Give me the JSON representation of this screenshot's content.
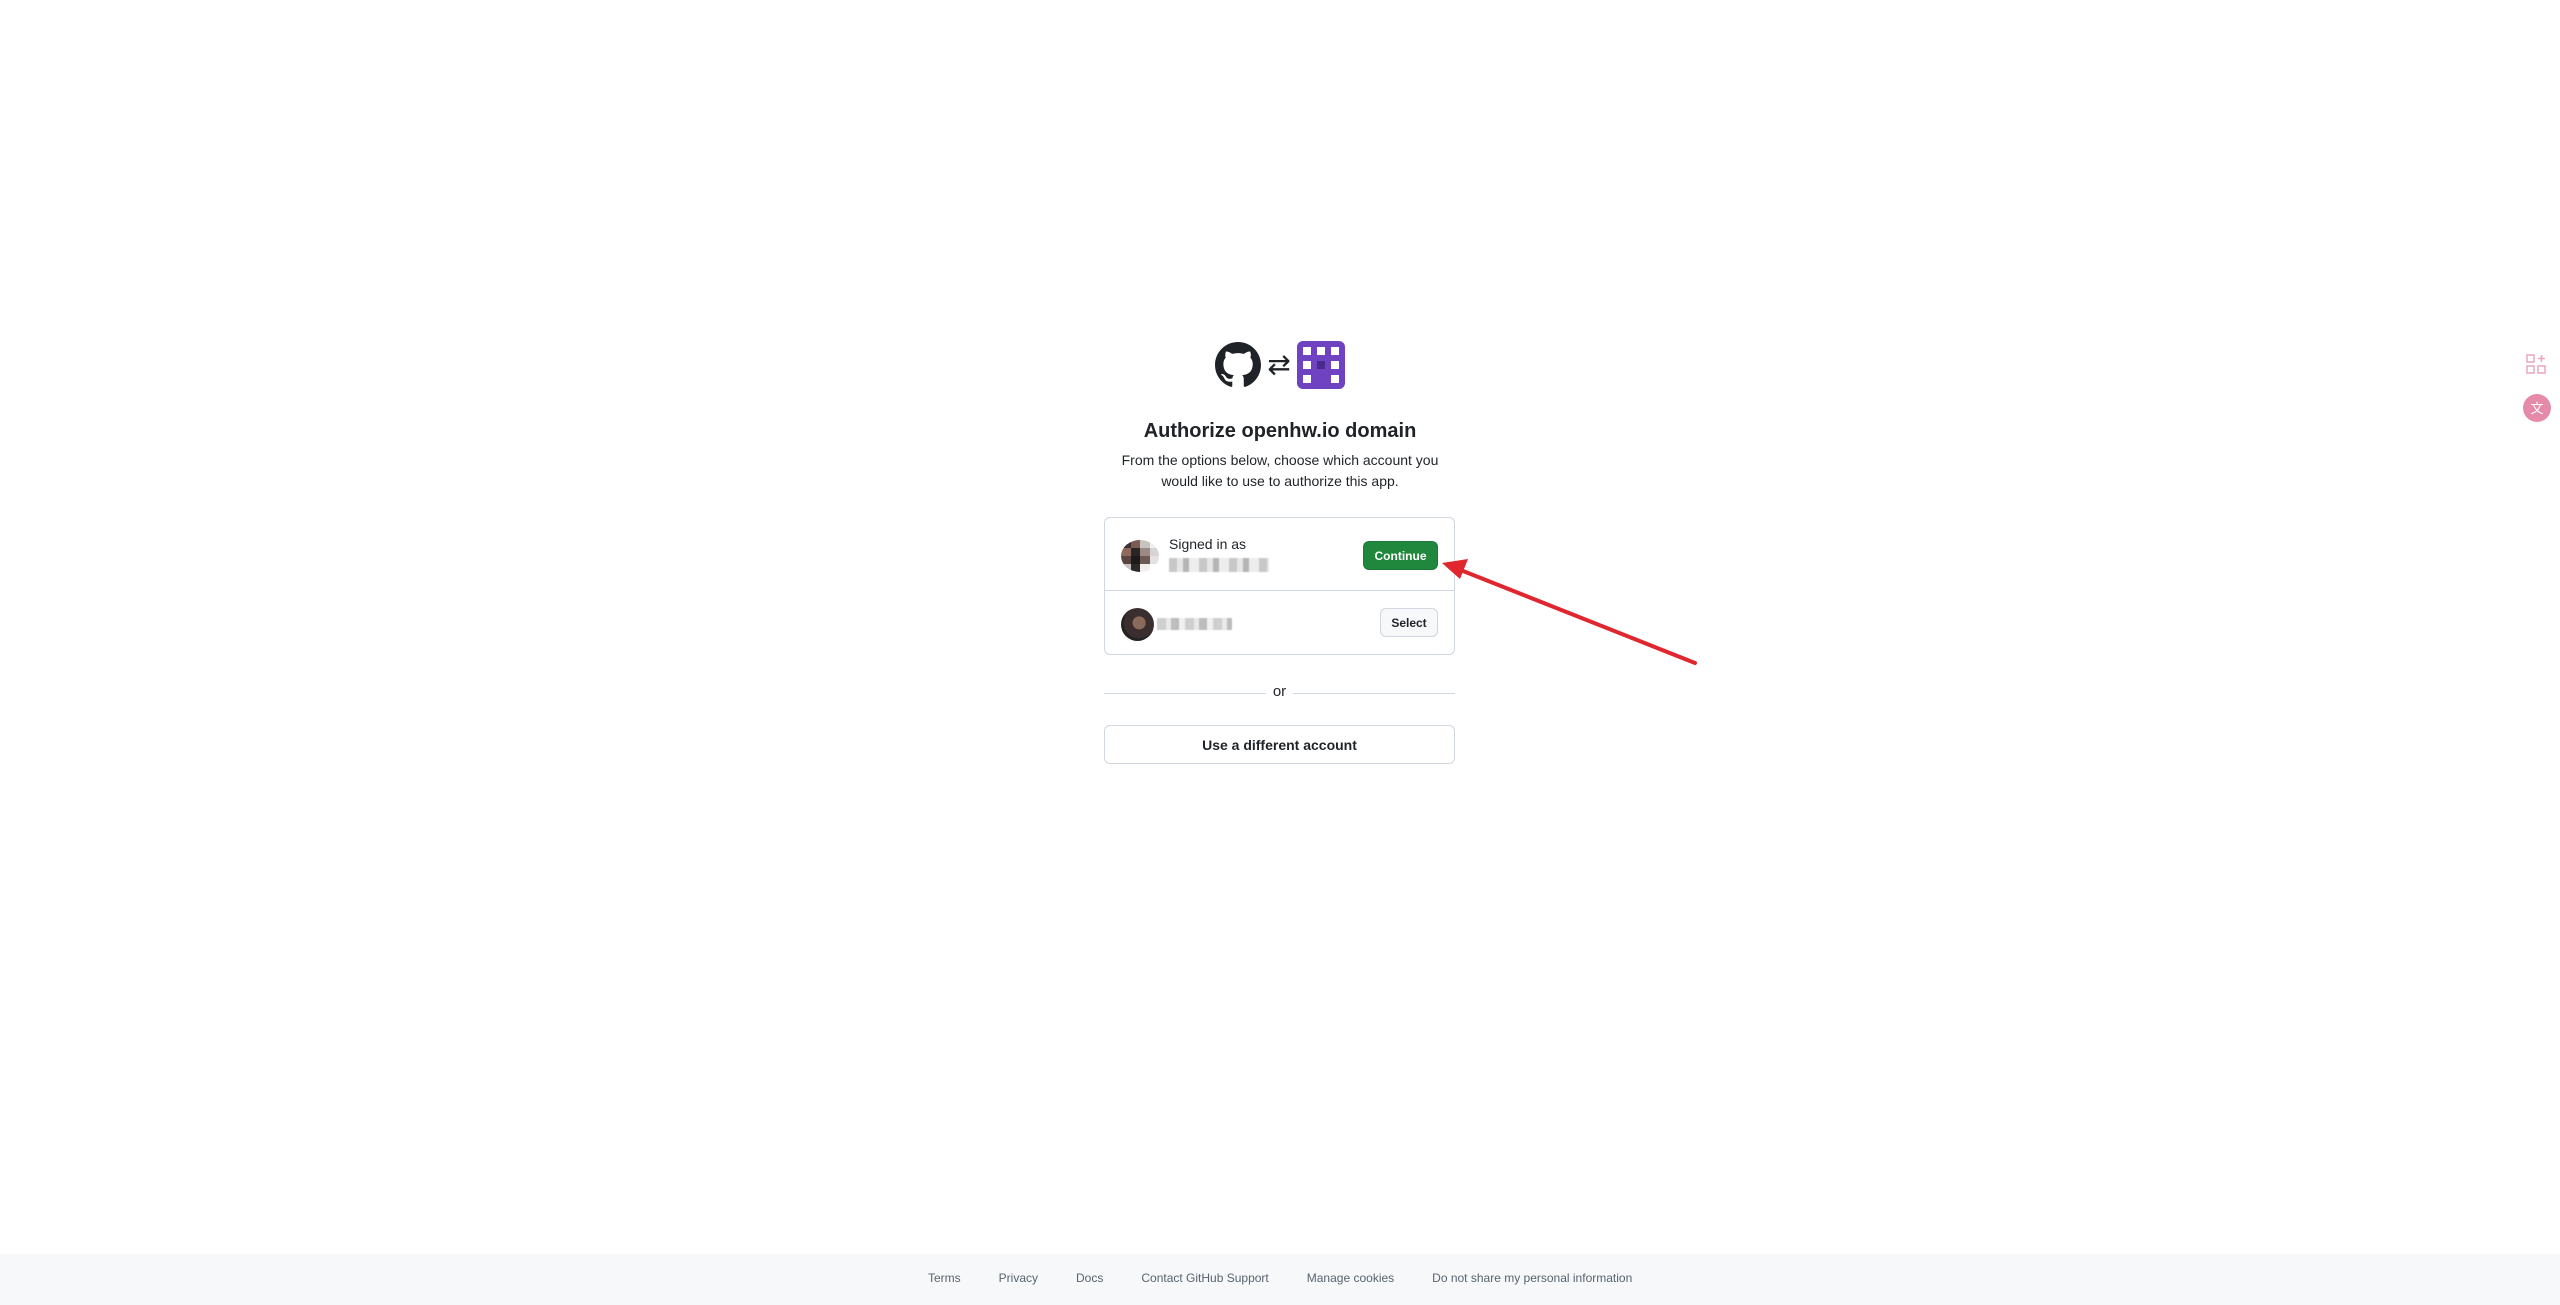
{
  "header": {
    "title": "Authorize openhw.io domain",
    "subtitle": "From the options below, choose which account you would like to use to authorize this app.",
    "swap_symbol": "⇄",
    "left_logo": "github-icon",
    "right_logo": "app-logo-icon"
  },
  "accounts": [
    {
      "status_label": "Signed in as",
      "action_label": "Continue",
      "action_color": "#1f883d"
    },
    {
      "action_label": "Select"
    }
  ],
  "divider": {
    "label": "or"
  },
  "alternate": {
    "button_label": "Use a different account"
  },
  "footer": {
    "links": [
      "Terms",
      "Privacy",
      "Docs",
      "Contact GitHub Support",
      "Manage cookies",
      "Do not share my personal information"
    ]
  },
  "colors": {
    "primary_button": "#1f883d",
    "app_logo": "#6f42c1",
    "annotation_arrow": "#e0262f",
    "border": "#d0d7de",
    "footer_bg": "#f6f8fa"
  }
}
